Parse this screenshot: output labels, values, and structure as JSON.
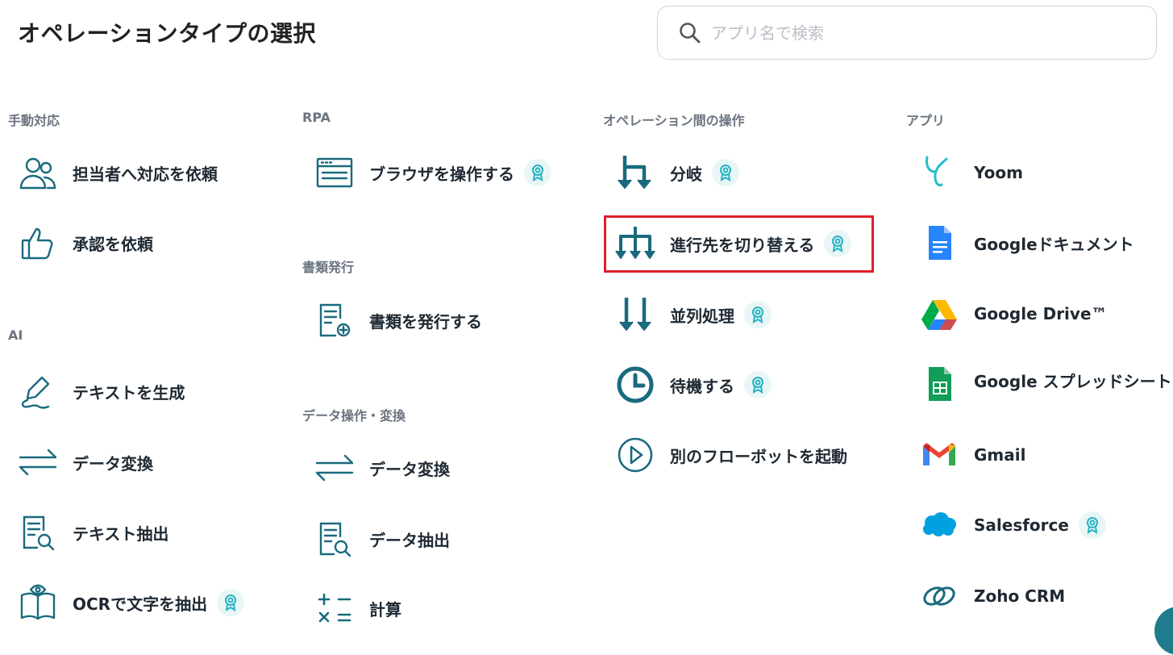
{
  "header": {
    "title": "オペレーションタイプの選択",
    "search_placeholder": "アプリ名で検索"
  },
  "columns": {
    "manual": {
      "heading": "手動対応",
      "items": [
        {
          "label": "担当者へ対応を依頼",
          "icon": "people-icon",
          "badge": false
        },
        {
          "label": "承認を依頼",
          "icon": "thumbs-up-icon",
          "badge": false
        }
      ]
    },
    "ai": {
      "heading": "AI",
      "items": [
        {
          "label": "テキストを生成",
          "icon": "pen-icon",
          "badge": false
        },
        {
          "label": "データ変換",
          "icon": "swap-arrows-icon",
          "badge": false
        },
        {
          "label": "テキスト抽出",
          "icon": "document-search-icon",
          "badge": false
        },
        {
          "label": "OCRで文字を抽出",
          "icon": "book-eye-icon",
          "badge": true
        }
      ]
    },
    "rpa": {
      "heading": "RPA",
      "items": [
        {
          "label": "ブラウザを操作する",
          "icon": "browser-window-icon",
          "badge": true
        }
      ]
    },
    "documents": {
      "heading": "書類発行",
      "items": [
        {
          "label": "書類を発行する",
          "icon": "document-add-icon",
          "badge": false
        }
      ]
    },
    "data_ops": {
      "heading": "データ操作・変換",
      "items": [
        {
          "label": "データ変換",
          "icon": "swap-arrows-icon",
          "badge": false
        },
        {
          "label": "データ抽出",
          "icon": "document-search-icon",
          "badge": false
        },
        {
          "label": "計算",
          "icon": "calculator-icon",
          "badge": false
        }
      ]
    },
    "between_ops": {
      "heading": "オペレーション間の操作",
      "items": [
        {
          "label": "分岐",
          "icon": "branch-icon",
          "badge": true
        },
        {
          "label": "進行先を切り替える",
          "icon": "multi-branch-icon",
          "badge": true
        },
        {
          "label": "並列処理",
          "icon": "parallel-arrows-icon",
          "badge": true
        },
        {
          "label": "待機する",
          "icon": "clock-icon",
          "badge": true
        },
        {
          "label": "別のフローボットを起動",
          "icon": "play-circle-icon",
          "badge": false
        }
      ]
    },
    "apps": {
      "heading": "アプリ",
      "items": [
        {
          "label": "Yoom",
          "icon": "yoom-logo-icon",
          "badge": false
        },
        {
          "label": "Googleドキュメント",
          "icon": "google-docs-icon",
          "badge": false
        },
        {
          "label": "Google Drive™",
          "icon": "google-drive-icon",
          "badge": false
        },
        {
          "label": "Google スプレッドシート",
          "icon": "google-sheets-icon",
          "badge": false
        },
        {
          "label": "Gmail",
          "icon": "gmail-icon",
          "badge": false
        },
        {
          "label": "Salesforce",
          "icon": "salesforce-cloud-icon",
          "badge": true
        },
        {
          "label": "Zoho CRM",
          "icon": "zoho-crm-icon",
          "badge": false
        }
      ]
    }
  },
  "selected_item": "進行先を切り替える",
  "colors": {
    "icon_primary": "#1a6a7e",
    "badge_bg": "#e9f6f7",
    "badge_icon": "#27b3c2",
    "highlight": "#e0202a",
    "heading": "#6b7480"
  }
}
